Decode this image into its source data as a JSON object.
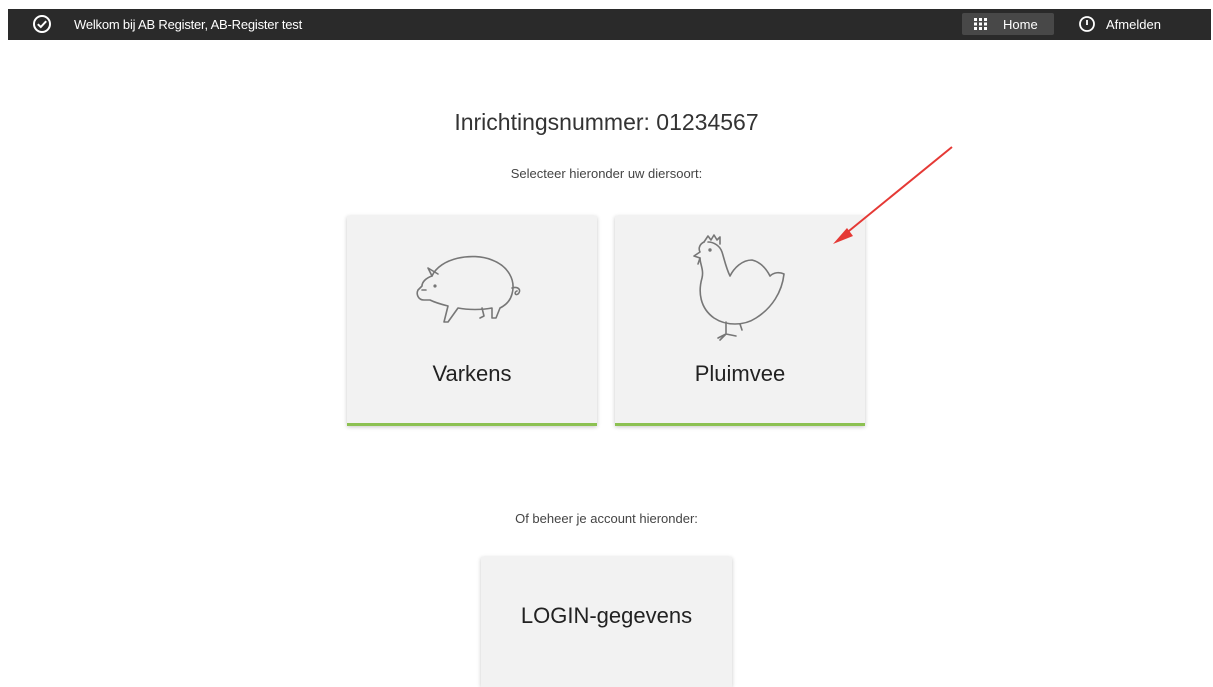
{
  "topbar": {
    "welcome": "Welkom bij AB Register, AB-Register test",
    "home_label": "Home",
    "logout_label": "Afmelden"
  },
  "main": {
    "heading": "Inrichtingsnummer: 01234567",
    "select_prompt": "Selecteer hieronder uw diersoort:",
    "animals": [
      {
        "label": "Varkens",
        "icon": "pig-icon"
      },
      {
        "label": "Pluimvee",
        "icon": "chicken-icon"
      }
    ],
    "account_prompt": "Of beheer je account hieronder:",
    "account_card_label": "LOGIN-gegevens"
  },
  "colors": {
    "topbar_bg": "#2a2a2a",
    "card_bg": "#f2f2f2",
    "card_accent": "#8cc152",
    "annotation_arrow": "#e53935"
  }
}
